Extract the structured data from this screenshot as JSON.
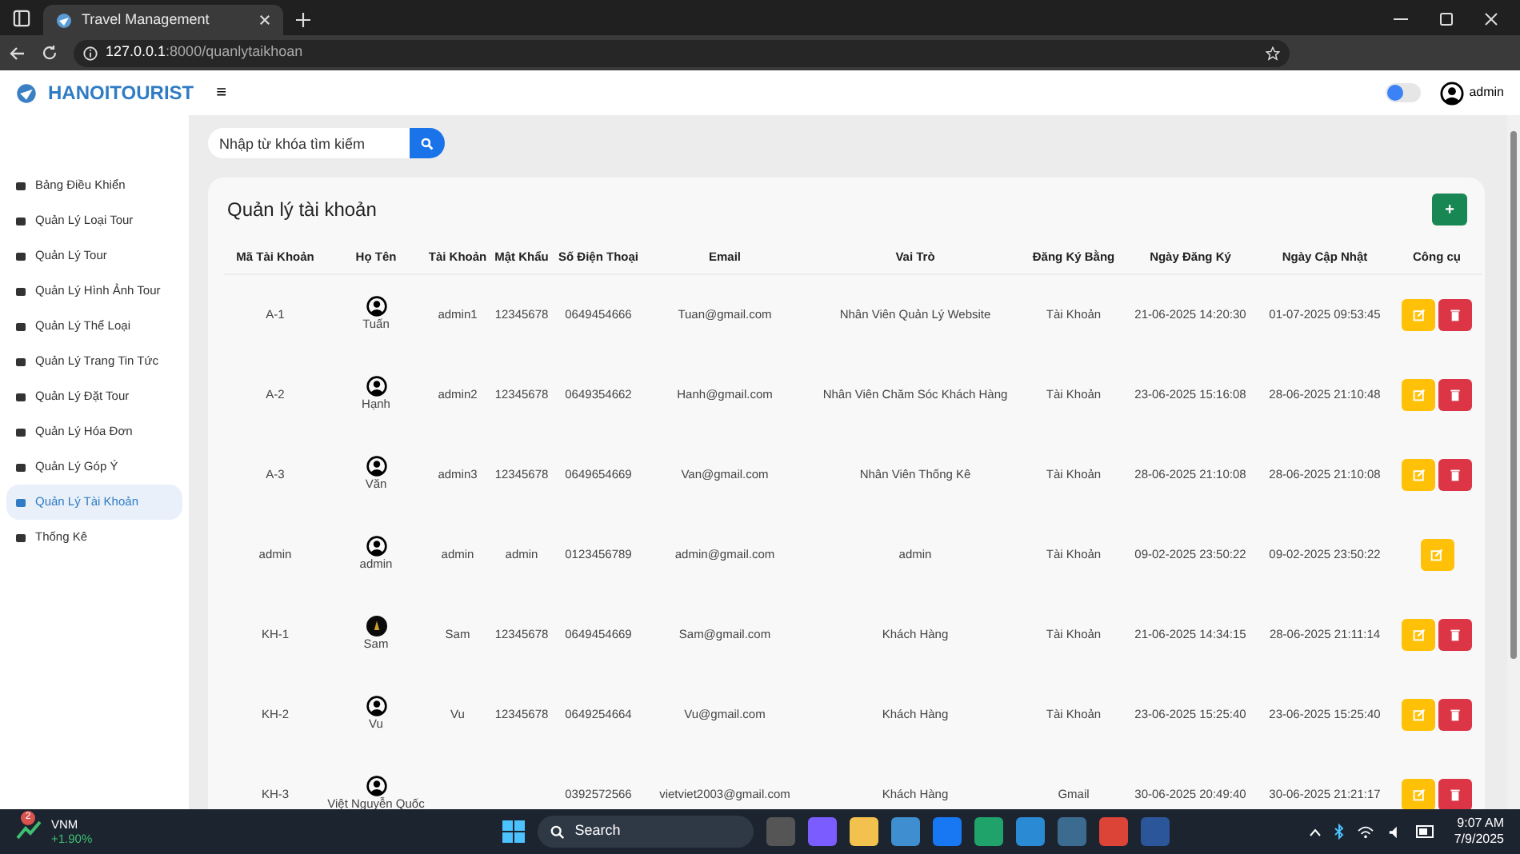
{
  "browser": {
    "tab_title": "Travel Management",
    "url_host": "127.0.0.1",
    "url_path": ":8000/quanlytaikhoan"
  },
  "header": {
    "brand": "HANOITOURIST",
    "menu_glyph": "≡",
    "theme_toggle": {
      "on": false
    },
    "user": "admin"
  },
  "sidebar": {
    "items": [
      {
        "label": "Bảng Điều Khiển",
        "selected": false
      },
      {
        "label": "Quản Lý Loại Tour",
        "selected": false
      },
      {
        "label": "Quản Lý Tour",
        "selected": false
      },
      {
        "label": "Quản Lý Hình Ảnh Tour",
        "selected": false
      },
      {
        "label": "Quản Lý Thể Loại",
        "selected": false
      },
      {
        "label": "Quản Lý Trang Tin Tức",
        "selected": false
      },
      {
        "label": "Quản Lý Đặt Tour",
        "selected": false
      },
      {
        "label": "Quản Lý Hóa Đơn",
        "selected": false
      },
      {
        "label": "Quản Lý Góp Ý",
        "selected": false
      },
      {
        "label": "Quản Lý Tài Khoản",
        "selected": true
      },
      {
        "label": "Thống Kê",
        "selected": false
      }
    ]
  },
  "search": {
    "placeholder": "Nhập từ khóa tìm kiếm"
  },
  "card": {
    "title": "Quản lý tài khoản",
    "add_glyph": "+"
  },
  "table": {
    "columns": [
      "Mã Tài Khoản",
      "Họ Tên",
      "Tài Khoản",
      "Mật Khẩu",
      "Số Điện Thoại",
      "Email",
      "Vai Trò",
      "Đăng Ký Bằng",
      "Ngày Đăng Ký",
      "Ngày Cập Nhật",
      "Công cụ"
    ],
    "rows": [
      {
        "id": "A-1",
        "photo_avatar": false,
        "name": "Tuấn",
        "account": "admin1",
        "password": "12345678",
        "phone": "0649454666",
        "email": "Tuan@gmail.com",
        "role": "Nhân Viên Quản Lý Website",
        "signup": "Tài Khoản",
        "created": "21-06-2025 14:20:30",
        "updated": "01-07-2025 09:53:45",
        "can_delete": true
      },
      {
        "id": "A-2",
        "photo_avatar": false,
        "name": "Hạnh",
        "account": "admin2",
        "password": "12345678",
        "phone": "0649354662",
        "email": "Hanh@gmail.com",
        "role": "Nhân Viên Chăm Sóc Khách Hàng",
        "signup": "Tài Khoản",
        "created": "23-06-2025 15:16:08",
        "updated": "28-06-2025 21:10:48",
        "can_delete": true
      },
      {
        "id": "A-3",
        "photo_avatar": false,
        "name": "Văn",
        "account": "admin3",
        "password": "12345678",
        "phone": "0649654669",
        "email": "Van@gmail.com",
        "role": "Nhân Viên Thống Kê",
        "signup": "Tài Khoản",
        "created": "28-06-2025 21:10:08",
        "updated": "28-06-2025 21:10:08",
        "can_delete": true
      },
      {
        "id": "admin",
        "photo_avatar": false,
        "name": "admin",
        "account": "admin",
        "password": "admin",
        "phone": "0123456789",
        "email": "admin@gmail.com",
        "role": "admin",
        "signup": "Tài Khoản",
        "created": "09-02-2025 23:50:22",
        "updated": "09-02-2025 23:50:22",
        "can_delete": false
      },
      {
        "id": "KH-1",
        "photo_avatar": true,
        "name": "Sam",
        "account": "Sam",
        "password": "12345678",
        "phone": "0649454669",
        "email": "Sam@gmail.com",
        "role": "Khách Hàng",
        "signup": "Tài Khoản",
        "created": "21-06-2025 14:34:15",
        "updated": "28-06-2025 21:11:14",
        "can_delete": true
      },
      {
        "id": "KH-2",
        "photo_avatar": false,
        "name": "Vu",
        "account": "Vu",
        "password": "12345678",
        "phone": "0649254664",
        "email": "Vu@gmail.com",
        "role": "Khách Hàng",
        "signup": "Tài Khoản",
        "created": "23-06-2025 15:25:40",
        "updated": "23-06-2025 15:25:40",
        "can_delete": true
      },
      {
        "id": "KH-3",
        "photo_avatar": false,
        "name": "Việt Nguyễn Quốc",
        "phone": "0392572566",
        "email": "vietviet2003@gmail.com",
        "role": "Khách Hàng",
        "signup": "Gmail",
        "created": "30-06-2025 20:49:40",
        "updated": "30-06-2025 21:21:17",
        "can_delete": true
      }
    ]
  },
  "taskbar": {
    "stock": {
      "name": "VNM",
      "change": "+1.90%",
      "badge": "2"
    },
    "search": "Search",
    "time": "9:07 AM",
    "date": "7/9/2025"
  }
}
